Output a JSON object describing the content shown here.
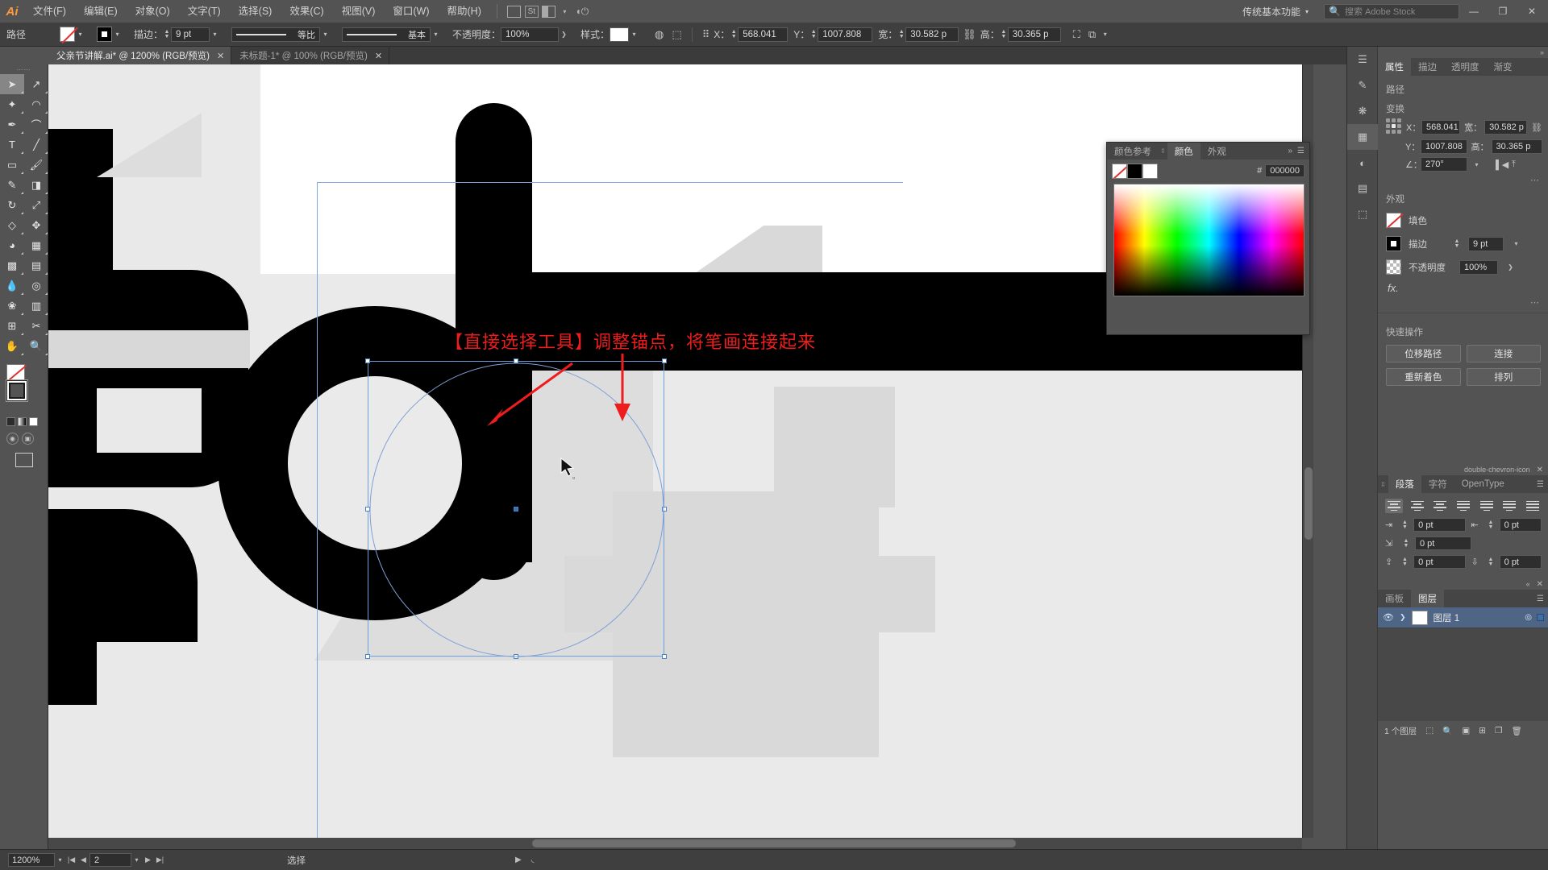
{
  "app": {
    "name": "Ai",
    "workspace": "传统基本功能",
    "stock_placeholder": "搜索 Adobe Stock"
  },
  "menu": {
    "items": [
      "文件(F)",
      "编辑(E)",
      "对象(O)",
      "文字(T)",
      "选择(S)",
      "效果(C)",
      "视图(V)",
      "窗口(W)",
      "帮助(H)"
    ],
    "icons": [
      "bridge-icon",
      "stock-icon",
      "arrange-documents-icon",
      "chevron-down-icon",
      "device-preview-icon"
    ]
  },
  "window_controls": {
    "minimize": "—",
    "restore": "❐",
    "close": "✕"
  },
  "controlbar": {
    "object_label": "路径",
    "fill_swatch": "none-swatch",
    "stroke_swatch": "black-stroke-swatch",
    "stroke_label": "描边：",
    "stroke_weight": "9 pt",
    "variable_width_profile": "等比",
    "brush_definition": "基本",
    "opacity_label": "不透明度：",
    "opacity_value": "100%",
    "style_label": "样式：",
    "x_label": "X：",
    "x_value": "568.041",
    "y_label": "Y：",
    "y_value": "1007.808",
    "w_label": "宽：",
    "w_value": "30.582 p",
    "h_label": "高：",
    "h_value": "30.365 p",
    "icons": [
      "recolor-artwork-icon",
      "transform-icon",
      "align-icon",
      "transform-each-icon",
      "chevron-down-icon"
    ]
  },
  "tabs": [
    {
      "title": "父亲节讲解.ai* @ 1200% (RGB/预览)",
      "active": true,
      "close": "✕"
    },
    {
      "title": "未标题-1* @ 100% (RGB/预览)",
      "active": false,
      "close": "✕"
    }
  ],
  "toolbox": {
    "tools": [
      {
        "name": "selection-tool",
        "glyph": "➤",
        "selected": true
      },
      {
        "name": "direct-selection-tool",
        "glyph": "↗",
        "selected": false
      },
      {
        "name": "magic-wand-tool",
        "glyph": "✦",
        "selected": false
      },
      {
        "name": "lasso-tool",
        "glyph": "◠",
        "selected": false
      },
      {
        "name": "pen-tool",
        "glyph": "✒",
        "selected": false
      },
      {
        "name": "curvature-tool",
        "glyph": "⌒",
        "selected": false
      },
      {
        "name": "type-tool",
        "glyph": "T",
        "selected": false
      },
      {
        "name": "line-segment-tool",
        "glyph": "╱",
        "selected": false
      },
      {
        "name": "rectangle-tool",
        "glyph": "▭",
        "selected": false
      },
      {
        "name": "paintbrush-tool",
        "glyph": "🖌",
        "selected": false
      },
      {
        "name": "shaper-tool",
        "glyph": "✎",
        "selected": false
      },
      {
        "name": "eraser-tool",
        "glyph": "◨",
        "selected": false
      },
      {
        "name": "rotate-tool",
        "glyph": "↻",
        "selected": false
      },
      {
        "name": "scale-tool",
        "glyph": "⤢",
        "selected": false
      },
      {
        "name": "width-tool",
        "glyph": "◇",
        "selected": false
      },
      {
        "name": "free-transform-tool",
        "glyph": "✥",
        "selected": false
      },
      {
        "name": "shape-builder-tool",
        "glyph": "◕",
        "selected": false
      },
      {
        "name": "perspective-grid-tool",
        "glyph": "▦",
        "selected": false
      },
      {
        "name": "mesh-tool",
        "glyph": "▩",
        "selected": false
      },
      {
        "name": "gradient-tool",
        "glyph": "▤",
        "selected": false
      },
      {
        "name": "eyedropper-tool",
        "glyph": "💧",
        "selected": false
      },
      {
        "name": "blend-tool",
        "glyph": "◎",
        "selected": false
      },
      {
        "name": "symbol-sprayer-tool",
        "glyph": "❀",
        "selected": false
      },
      {
        "name": "column-graph-tool",
        "glyph": "▥",
        "selected": false
      },
      {
        "name": "artboard-tool",
        "glyph": "⊞",
        "selected": false
      },
      {
        "name": "slice-tool",
        "glyph": "✂",
        "selected": false
      },
      {
        "name": "hand-tool",
        "glyph": "✋",
        "selected": false
      },
      {
        "name": "zoom-tool",
        "glyph": "🔍",
        "selected": false
      }
    ],
    "fill_label": "fill-swatch",
    "stroke_label": "stroke-swatch"
  },
  "canvas": {
    "annotation": "【直接选择工具】调整锚点，将笔画连接起来",
    "annotation_color": "#ee1c1c",
    "artwork_color": "#000000",
    "background_shape_color": "#dddddd"
  },
  "color_panel": {
    "tabs": [
      "颜色参考",
      "颜色",
      "外观"
    ],
    "active_tab": "颜色",
    "hex_prefix": "#",
    "hex_value": "000000",
    "swatches": [
      "none",
      "black",
      "white"
    ],
    "menu_icon": "panel-menu-icon",
    "collapse_icon": "double-chevron-icon"
  },
  "properties": {
    "tabs": [
      "属性",
      "描边",
      "透明度",
      "渐变"
    ],
    "active_tab": "属性",
    "object_type": "路径",
    "transform": {
      "title": "变换",
      "x_label": "X：",
      "x_value": "568.041",
      "y_label": "Y：",
      "y_value": "1007.808",
      "w_label": "宽：",
      "w_value": "30.582 p",
      "h_label": "高：",
      "h_value": "30.365 p",
      "angle_label": "∠：",
      "angle_value": "270°",
      "link_icon": "link-broken-icon",
      "flip_h_icon": "flip-horizontal-icon",
      "flip_v_icon": "flip-vertical-icon",
      "more_options": "⋯"
    },
    "appearance": {
      "title": "外观",
      "fill_label": "填色",
      "stroke_label": "描边",
      "stroke_weight": "9 pt",
      "opacity_label": "不透明度",
      "opacity_value": "100%",
      "fx_label": "fx.",
      "more_options": "⋯"
    },
    "quick_actions": {
      "title": "快速操作",
      "buttons": [
        "位移路径",
        "连接",
        "重新着色",
        "排列"
      ]
    }
  },
  "paragraph_panel": {
    "tabs": [
      "段落",
      "字符",
      "OpenType"
    ],
    "active_tab": "段落",
    "align_buttons": [
      "align-left",
      "align-center",
      "align-right",
      "justify-last-left",
      "justify-last-center",
      "justify-last-right",
      "justify-all"
    ],
    "indent_left": "0 pt",
    "indent_right": "0 pt",
    "indent_first_line": "0 pt",
    "space_before": "0 pt",
    "space_after": "0 pt",
    "collapse_icon": "double-chevron-icon",
    "close_icon": "✕"
  },
  "layers_panel": {
    "tabs": [
      "画板",
      "图层"
    ],
    "active_tab": "图层",
    "layer_name": "图层 1",
    "count_text": "1 个图层",
    "visibility_icon": "eye-icon",
    "expand_icon": "chevron-right-icon",
    "target_icon": "target-circle-icon",
    "select_icon": "selection-square-icon",
    "footer_icons": [
      "locate-object-icon",
      "make-mask-icon",
      "new-sublayer-icon",
      "new-layer-icon",
      "delete-layer-icon"
    ],
    "menu_icon": "panel-menu-icon"
  },
  "dock_icons": [
    {
      "name": "libraries-icon",
      "glyph": "☰"
    },
    {
      "name": "brushes-icon",
      "glyph": "🖌"
    },
    {
      "name": "symbols-icon",
      "glyph": "❋"
    },
    {
      "name": "swatches-icon",
      "glyph": "▦"
    },
    {
      "name": "pathfinder-icon",
      "glyph": "◐"
    },
    {
      "name": "align-panel-icon",
      "glyph": "▤"
    },
    {
      "name": "transform-panel-icon",
      "glyph": "⬚"
    }
  ],
  "statusbar": {
    "zoom": "1200%",
    "first_icon": "first-page-icon",
    "prev_icon": "prev-page-icon",
    "page": "2",
    "next_icon": "next-page-icon",
    "last_icon": "last-page-icon",
    "status_text": "选择",
    "nav_right": "▶",
    "nav_grip": "◟"
  }
}
